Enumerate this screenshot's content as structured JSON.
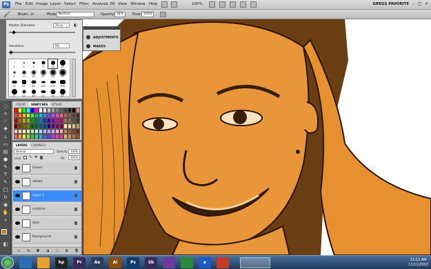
{
  "app": {
    "logo": "Ps"
  },
  "menu": [
    "File",
    "Edit",
    "Image",
    "Layer",
    "Select",
    "Filter",
    "Analysis",
    "3D",
    "View",
    "Window",
    "Help"
  ],
  "zoom": "100%",
  "workspace": "GREGS FAVORITE",
  "window_buttons": [
    "-",
    "□",
    "×"
  ],
  "options": {
    "brush_label": "Brush:",
    "brush_size": "30",
    "mode_label": "Mode:",
    "mode_value": "Normal",
    "opacity_label": "Opacity:",
    "opacity_value": "34%",
    "flow_label": "Flow:",
    "flow_value": "100%"
  },
  "brush_popup": {
    "diameter_label": "Master Diameter",
    "diameter_value": "30 px",
    "hardness_label": "Hardness:",
    "hardness_value": "0%",
    "brush_sizes": [
      "1",
      "3",
      "5",
      "9",
      "13",
      "19",
      "5",
      "9",
      "13",
      "17",
      "21",
      "27",
      "35",
      "45",
      "65",
      "100",
      "200",
      "300",
      "9",
      "13",
      "19",
      "17",
      "45",
      "65"
    ]
  },
  "adjustments": {
    "items": [
      "ADJUSTMENTS",
      "MASKS"
    ]
  },
  "swatches": {
    "tabs": [
      "COLOR",
      "SWATCHES",
      "STYLES"
    ],
    "colors": [
      "#ff0000",
      "#ffff00",
      "#00ff00",
      "#00ffff",
      "#0000ff",
      "#ff00ff",
      "#ffffff",
      "#e0e0e0",
      "#c0c0c0",
      "#a0a0a0",
      "#808080",
      "#606060",
      "#404040",
      "#202020",
      "#000000",
      "#ff8080",
      "#ff4040",
      "#ff8000",
      "#ffc000",
      "#c0ff00",
      "#40ff40",
      "#00c080",
      "#00c0ff",
      "#4080ff",
      "#8040ff",
      "#c040ff",
      "#ff40c0",
      "#ff6080",
      "#c06040",
      "#806040",
      "#604020",
      "#403020",
      "#c00000",
      "#c06000",
      "#c0a000",
      "#80c000",
      "#00a000",
      "#008060",
      "#0080c0",
      "#0040c0",
      "#4000c0",
      "#8000c0",
      "#c000a0",
      "#c00060",
      "#a07050",
      "#807050",
      "#605040",
      "#403020",
      "#800000",
      "#804000",
      "#806000",
      "#608000",
      "#006000",
      "#006040",
      "#006080",
      "#004080",
      "#200080",
      "#600080",
      "#800060",
      "#800040",
      "#ffe0c0",
      "#f0d0a0",
      "#e0c080",
      "#c0a060",
      "#ffc0c0",
      "#ffe0a0",
      "#ffffa0",
      "#e0ffa0",
      "#a0ffa0",
      "#a0ffe0",
      "#a0e0ff",
      "#a0c0ff",
      "#c0a0ff",
      "#e0a0ff",
      "#ffa0e0",
      "#ffa0c0",
      "#d08040",
      "#b06020",
      "#904010",
      "#702000",
      "#ff6060",
      "#ffa040",
      "#ffe040",
      "#a0e040",
      "#40c040",
      "#40c0a0",
      "#40a0e0",
      "#4060e0",
      "#6040e0",
      "#a040e0",
      "#e040c0",
      "#e04080",
      "#f0b070",
      "#d09050",
      "#b07030",
      "#905020"
    ]
  },
  "layers": {
    "tabs": [
      "LAYERS",
      "CHANNELS"
    ],
    "blend_mode": "Normal",
    "opacity_label": "Opacity:",
    "opacity_value": "100%",
    "lock_label": "Lock:",
    "fill_label": "Fill:",
    "fill_value": "100%",
    "items": [
      {
        "name": "lineart",
        "selected": false
      },
      {
        "name": "details",
        "selected": false
      },
      {
        "name": "Layer 1",
        "selected": true
      },
      {
        "name": "midtone",
        "selected": false
      },
      {
        "name": "dark",
        "selected": false
      },
      {
        "name": "Background",
        "selected": false
      }
    ]
  },
  "taskbar": {
    "apps": [
      "",
      "",
      "hp",
      "Pr",
      "Ae",
      "Ai",
      "Ps",
      "Sb",
      "",
      "",
      "e",
      ""
    ],
    "time": "11:12 AM",
    "date": "11/11/2013"
  }
}
